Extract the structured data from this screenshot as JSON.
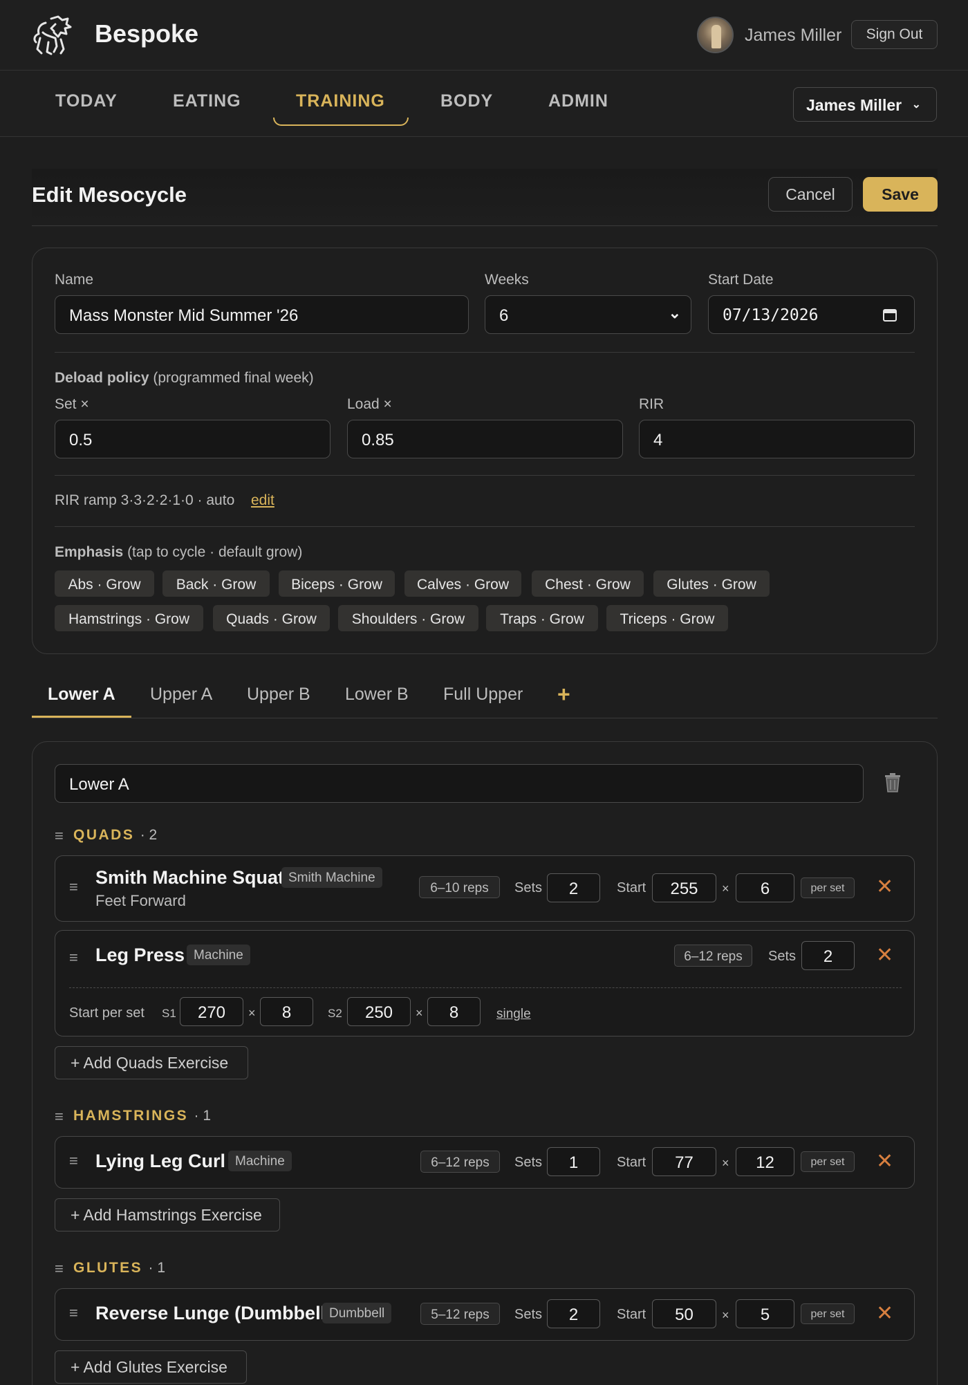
{
  "app": {
    "brand": "Bespoke",
    "user_name": "James Miller",
    "sign_out": "Sign Out"
  },
  "nav": {
    "tabs": [
      "TODAY",
      "EATING",
      "TRAINING",
      "BODY",
      "ADMIN"
    ],
    "active_tab": "TRAINING",
    "user_select": "James Miller"
  },
  "page": {
    "title": "Edit Mesocycle",
    "cancel": "Cancel",
    "save": "Save"
  },
  "meso": {
    "name_label": "Name",
    "name_value": "Mass Monster Mid Summer '26",
    "weeks_label": "Weeks",
    "weeks_value": "6",
    "start_label": "Start Date",
    "start_value": "07/13/2026",
    "deload_title": "Deload policy",
    "deload_note": "(programmed final week)",
    "set_label": "Set ×",
    "set_value": "0.5",
    "load_label": "Load ×",
    "load_value": "0.85",
    "rir_label": "RIR",
    "rir_value": "4",
    "rir_ramp": "RIR ramp 3·3·2·2·1·0 · auto",
    "rir_edit": "edit",
    "emphasis_title": "Emphasis",
    "emphasis_note": "(tap to cycle · default grow)",
    "emphasis": [
      "Abs · Grow",
      "Back · Grow",
      "Biceps · Grow",
      "Calves · Grow",
      "Chest · Grow",
      "Glutes · Grow",
      "Hamstrings · Grow",
      "Quads · Grow",
      "Shoulders · Grow",
      "Traps · Grow",
      "Triceps · Grow"
    ]
  },
  "days": {
    "tabs": [
      "Lower A",
      "Upper A",
      "Upper B",
      "Lower B",
      "Full Upper"
    ],
    "active": "Lower A",
    "add": "+"
  },
  "day": {
    "name_value": "Lower A",
    "groups": [
      {
        "name": "QUADS",
        "count": "· 2",
        "add": "+ Add Quads Exercise",
        "exercises": [
          {
            "name": "Smith Machine Squat",
            "tag": "Smith Machine",
            "sub": "Feet Forward",
            "reps": "6–10 reps",
            "sets_label": "Sets",
            "sets": "2",
            "start_label": "Start",
            "load": "255",
            "x": "×",
            "reps_val": "6",
            "perset": "per set"
          },
          {
            "name": "Leg Press",
            "tag": "Machine",
            "reps": "6–12 reps",
            "sets_label": "Sets",
            "sets": "2",
            "per_set_label": "Start per set",
            "s1_label": "S1",
            "s1_load": "270",
            "s1_reps": "8",
            "s2_label": "S2",
            "s2_load": "250",
            "s2_reps": "8",
            "x": "×",
            "single": "single"
          }
        ]
      },
      {
        "name": "HAMSTRINGS",
        "count": "· 1",
        "add": "+ Add Hamstrings Exercise",
        "exercises": [
          {
            "name": "Lying Leg Curl",
            "tag": "Machine",
            "reps": "6–12 reps",
            "sets_label": "Sets",
            "sets": "1",
            "start_label": "Start",
            "load": "77",
            "x": "×",
            "reps_val": "12",
            "perset": "per set"
          }
        ]
      },
      {
        "name": "GLUTES",
        "count": "· 1",
        "add": "+ Add Glutes Exercise",
        "exercises": [
          {
            "name": "Reverse Lunge (Dumbbell)",
            "tag": "Dumbbell",
            "reps": "5–12 reps",
            "sets_label": "Sets",
            "sets": "2",
            "start_label": "Start",
            "load": "50",
            "x": "×",
            "reps_val": "5",
            "perset": "per set"
          }
        ]
      }
    ]
  },
  "icons": {
    "logo": "lion-logo-icon",
    "chevron": "chevron-down-icon",
    "calendar": "calendar-icon",
    "trash": "trash-icon",
    "grip": "drag-handle-icon",
    "remove": "close-icon"
  },
  "colors": {
    "accent": "#d9b45a",
    "danger": "#d77f3f",
    "bg": "#1e1e1e"
  }
}
